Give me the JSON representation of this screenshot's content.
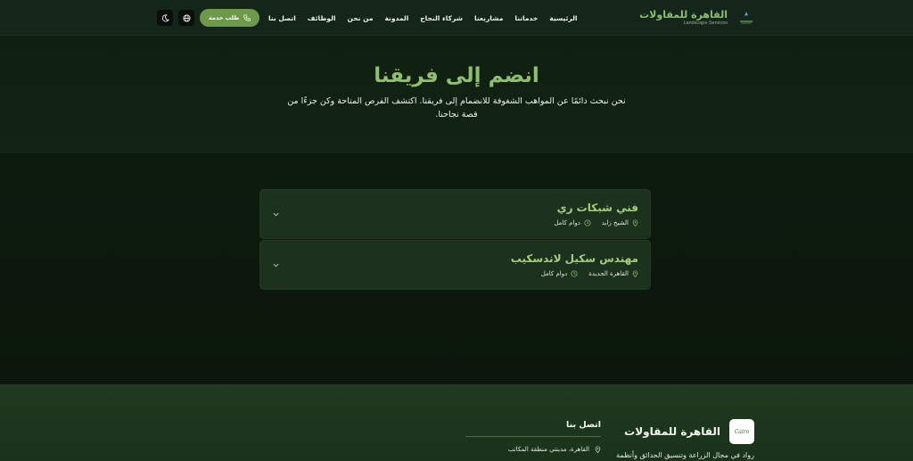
{
  "nav": {
    "brand_title": "القاهرة للمقاولات",
    "brand_subtitle": "Landscape Services",
    "links": [
      "الرئيسية",
      "خدماتنا",
      "مشاريعنا",
      "شركاء النجاح",
      "المدونة",
      "من نحن",
      "الوظائف",
      "اتصل بنا"
    ],
    "cta_label": "طلب خدمة",
    "icons": {
      "cta": "phone-icon",
      "language": "globe-icon",
      "theme": "moon-icon"
    }
  },
  "hero": {
    "title": "انضم إلى فريقنا",
    "subtitle": "نحن نبحث دائمًا عن المواهب الشغوفة للانضمام إلى فريقنا. اكتشف الفرص المتاحة وكن جزءًا من قصة نجاحنا."
  },
  "jobs": [
    {
      "title": "فني شبكات ري",
      "location": "الشيخ زايد",
      "type": "دوام كامل"
    },
    {
      "title": "مهندس سكيل لاندسكيب",
      "location": "القاهرة الجديدة",
      "type": "دوام كامل"
    }
  ],
  "footer": {
    "logo_text": "Cairo",
    "brand_title": "القاهرة للمقاولات",
    "description": "رواد في مجال الزراعة وتنسيق الحدائق وأنظمة",
    "contact_title": "اتصل بنا",
    "address": "القاهرة، مدينتي منطقة المكاتب"
  },
  "colors": {
    "accent": "#8fbf6a",
    "cta": "#6d9a4a",
    "card": "#1c321e",
    "background": "#0e1a0e",
    "footer": "#1f3a20"
  }
}
